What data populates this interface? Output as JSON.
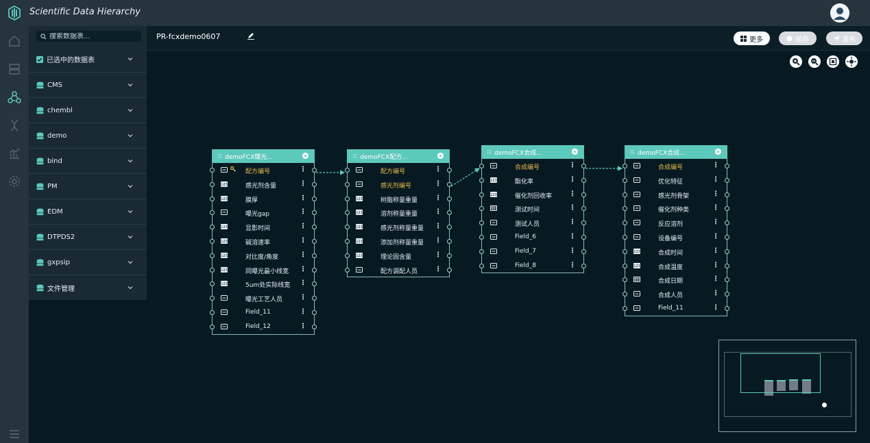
{
  "app": {
    "title": "Scientific Data Hierarchy"
  },
  "sidebar": {
    "search_placeholder": "搜索数据表...",
    "items": [
      {
        "label": "已选中的数据表",
        "icon": "checkbox-icon"
      },
      {
        "label": "CMS",
        "icon": "database-icon"
      },
      {
        "label": "chembl",
        "icon": "database-icon"
      },
      {
        "label": "demo",
        "icon": "database-icon"
      },
      {
        "label": "bind",
        "icon": "database-icon"
      },
      {
        "label": "PM",
        "icon": "database-icon"
      },
      {
        "label": "EDM",
        "icon": "database-icon"
      },
      {
        "label": "DTPDS2",
        "icon": "database-icon"
      },
      {
        "label": "gxpsip",
        "icon": "database-icon"
      },
      {
        "label": "文件管理",
        "icon": "database-icon"
      }
    ]
  },
  "toolbar": {
    "project_title": "PR-fcxdemo0607",
    "more_label": "更多",
    "save_label": "保存",
    "publish_label": "发布"
  },
  "tables": [
    {
      "title": "demoFCX曝光...",
      "fields": [
        {
          "name": "配方编号",
          "type": "text",
          "key": true,
          "hl": true
        },
        {
          "name": "感光剂含量",
          "type": "num"
        },
        {
          "name": "膜厚",
          "type": "num"
        },
        {
          "name": "曝光gap",
          "type": "text"
        },
        {
          "name": "显影时间",
          "type": "num"
        },
        {
          "name": "碱溶速率",
          "type": "num"
        },
        {
          "name": "对比度/角度",
          "type": "num"
        },
        {
          "name": "同曝光最小线宽",
          "type": "num"
        },
        {
          "name": "5um处实际线宽",
          "type": "num"
        },
        {
          "name": "曝光工艺人员",
          "type": "text"
        },
        {
          "name": "Field_11",
          "type": "text"
        },
        {
          "name": "Field_12",
          "type": "text"
        }
      ]
    },
    {
      "title": "demoFCX配方...",
      "fields": [
        {
          "name": "配方编号",
          "type": "text",
          "hl": true
        },
        {
          "name": "感光剂编号",
          "type": "text",
          "hl": true
        },
        {
          "name": "树脂称量重量",
          "type": "num"
        },
        {
          "name": "溶剂称量重量",
          "type": "num"
        },
        {
          "name": "感光剂称量重量",
          "type": "num"
        },
        {
          "name": "添加剂称量重量",
          "type": "num"
        },
        {
          "name": "理论固含量",
          "type": "num"
        },
        {
          "name": "配方调配人员",
          "type": "text"
        }
      ]
    },
    {
      "title": "demoFCX合成...",
      "fields": [
        {
          "name": "合成编号",
          "type": "text",
          "hl": true
        },
        {
          "name": "酯化率",
          "type": "num"
        },
        {
          "name": "催化剂回收率",
          "type": "num"
        },
        {
          "name": "测试时间",
          "type": "date"
        },
        {
          "name": "测试人员",
          "type": "text"
        },
        {
          "name": "Field_6",
          "type": "text"
        },
        {
          "name": "Field_7",
          "type": "text"
        },
        {
          "name": "Field_8",
          "type": "text"
        }
      ]
    },
    {
      "title": "demoFCX合成...",
      "fields": [
        {
          "name": "合成编号",
          "type": "text",
          "hl": true
        },
        {
          "name": "优化特征",
          "type": "text"
        },
        {
          "name": "感光剂骨架",
          "type": "text"
        },
        {
          "name": "催化剂种类",
          "type": "text"
        },
        {
          "name": "反应溶剂",
          "type": "text"
        },
        {
          "name": "设备编号",
          "type": "text"
        },
        {
          "name": "合成时间",
          "type": "num"
        },
        {
          "name": "合成温度",
          "type": "num"
        },
        {
          "name": "合成日期",
          "type": "date"
        },
        {
          "name": "合成人员",
          "type": "text"
        },
        {
          "name": "Field_11",
          "type": "text"
        }
      ]
    }
  ]
}
